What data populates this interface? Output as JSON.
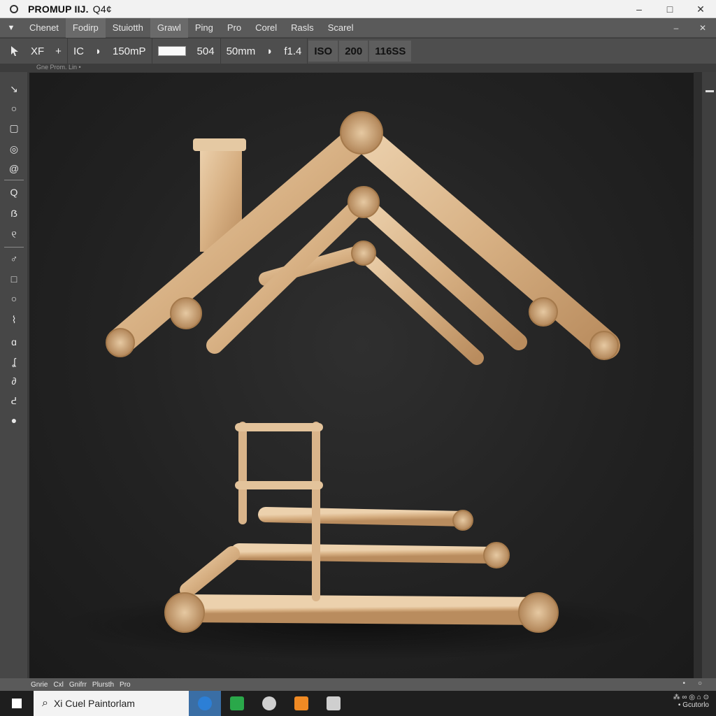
{
  "window": {
    "title": "PROMUP IIJ.",
    "title_suffix": "Q4¢",
    "min": "–",
    "max": "□",
    "close": "✕"
  },
  "menubar": {
    "items": [
      "Chenet",
      "Fodirp",
      "Stuiotth",
      "Grawl",
      "Ping",
      "Pro",
      "Corel",
      "Rasls",
      "Scarel"
    ],
    "right_min": "–",
    "right_close": "✕"
  },
  "options": {
    "xf": "XF",
    "plus": "+",
    "ic": "IC",
    "mp": "150mP",
    "val": "504",
    "focal": "50mm",
    "fstop": "f1.4",
    "iso_label": "ISO",
    "iso_value": "200",
    "shutter": "116SS"
  },
  "infostrip": {
    "text": "Gne Prom. Lin  •"
  },
  "tools": [
    {
      "name": "move-tool-icon",
      "glyph": "↘"
    },
    {
      "name": "circle-select-icon",
      "glyph": "○"
    },
    {
      "name": "rect-tool-icon",
      "glyph": "▢"
    },
    {
      "name": "lasso-icon",
      "glyph": "◎"
    },
    {
      "name": "spiral-icon",
      "glyph": "@"
    },
    {
      "name": "zoom-tool-icon",
      "glyph": "Q"
    },
    {
      "name": "brush-tool-icon",
      "glyph": "ẞ"
    },
    {
      "name": "clone-tool-icon",
      "glyph": "୧"
    },
    {
      "name": "pen-tool-icon",
      "glyph": "♂"
    },
    {
      "name": "square-tool-icon",
      "glyph": "□"
    },
    {
      "name": "ellipse-tool-icon",
      "glyph": "○"
    },
    {
      "name": "path-tool-icon",
      "glyph": "⌇"
    },
    {
      "name": "dodge-tool-icon",
      "glyph": "ɑ"
    },
    {
      "name": "smudge-tool-icon",
      "glyph": "ʆ"
    },
    {
      "name": "drop-tool-icon",
      "glyph": "∂"
    },
    {
      "name": "hand-tool-icon",
      "glyph": "ᕍ"
    },
    {
      "name": "color-tool-icon",
      "glyph": "●"
    }
  ],
  "status": {
    "items": [
      "Gnrie",
      "Cxl",
      "Gnifrr",
      "Plursth",
      "Pro"
    ],
    "right1": "•",
    "right2": "○"
  },
  "taskbar": {
    "search_text": "Xi  Cuel  Paintorlam",
    "tray_line1": "⁂ ∞ ◎ ⌂ ⊙",
    "tray_line2": "• Gcutorlo"
  },
  "colors": {
    "accent": "#3a6ea5",
    "canvas_bg": "#222222",
    "wood": "#d9b48a"
  }
}
